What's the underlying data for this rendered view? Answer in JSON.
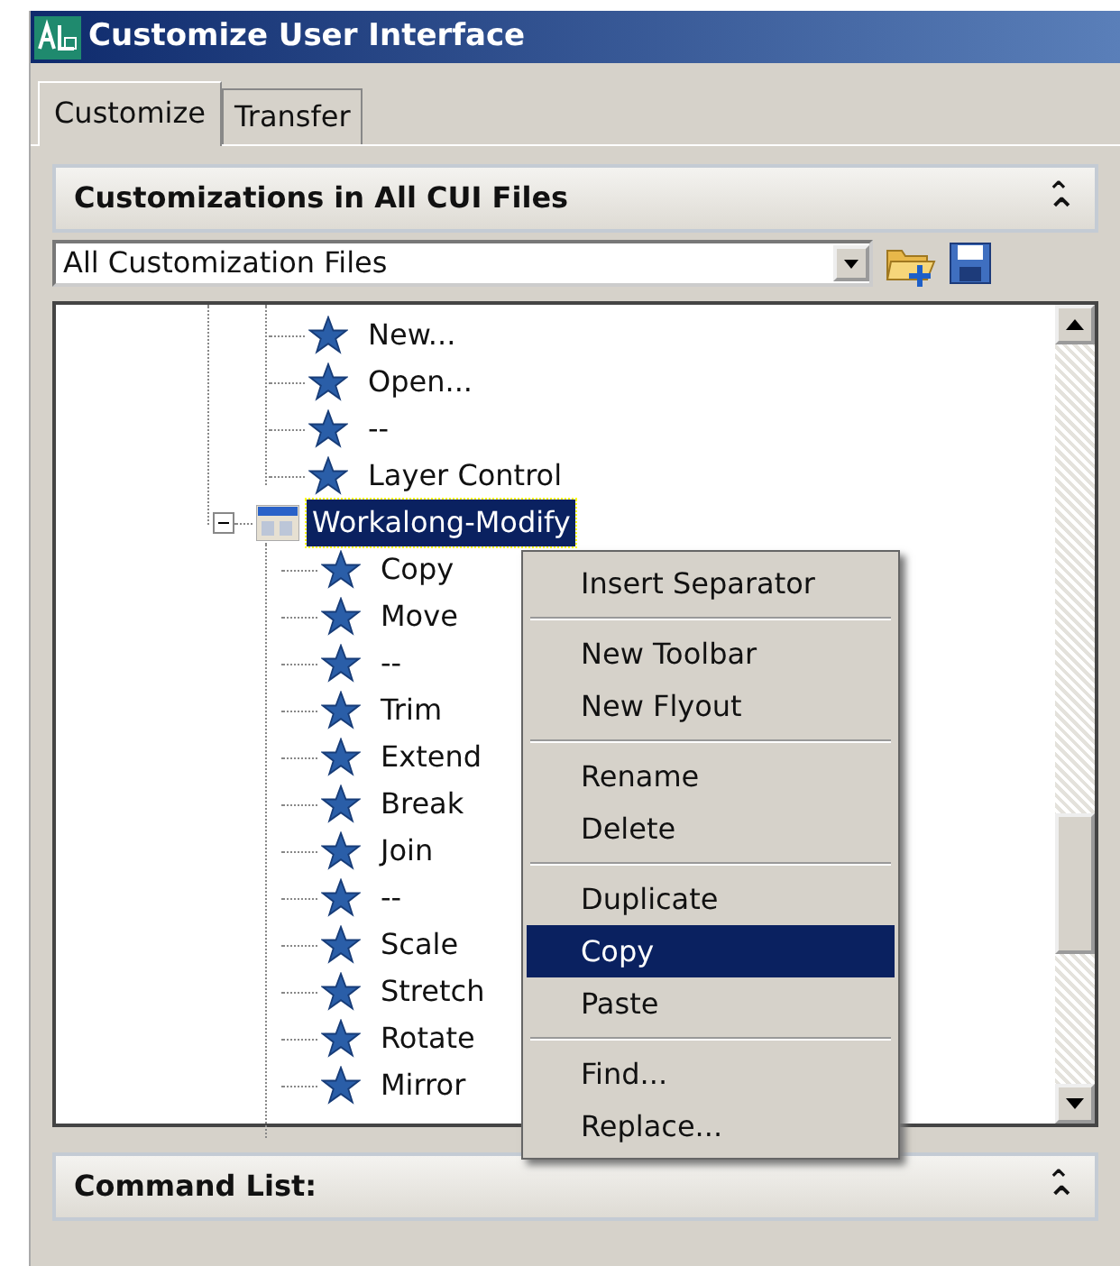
{
  "window": {
    "title": "Customize User Interface"
  },
  "tabs": [
    {
      "label": "Customize",
      "selected": true
    },
    {
      "label": "Transfer",
      "selected": false
    }
  ],
  "customizations_panel": {
    "title": "Customizations in All CUI Files",
    "collapse_glyph": "⌃",
    "file_filter": {
      "value": "All Customization Files"
    }
  },
  "tree": {
    "items": [
      {
        "label": "New...",
        "kind": "command",
        "selected": false
      },
      {
        "label": "Open...",
        "kind": "command",
        "selected": false
      },
      {
        "label": "--",
        "kind": "command",
        "selected": false
      },
      {
        "label": "Layer Control",
        "kind": "command",
        "selected": false
      },
      {
        "label": "Workalong-Modify",
        "kind": "toolbar",
        "selected": true,
        "expanded": true,
        "children": [
          {
            "label": "Copy",
            "kind": "command",
            "selected": false
          },
          {
            "label": "Move",
            "kind": "command",
            "selected": false
          },
          {
            "label": "--",
            "kind": "command",
            "selected": false
          },
          {
            "label": "Trim",
            "kind": "command",
            "selected": false
          },
          {
            "label": "Extend",
            "kind": "command",
            "selected": false
          },
          {
            "label": "Break",
            "kind": "command",
            "selected": false
          },
          {
            "label": "Join",
            "kind": "command",
            "selected": false
          },
          {
            "label": "--",
            "kind": "command",
            "selected": false
          },
          {
            "label": "Scale",
            "kind": "command",
            "selected": false
          },
          {
            "label": "Stretch",
            "kind": "command",
            "selected": false
          },
          {
            "label": "Rotate",
            "kind": "command",
            "selected": false
          },
          {
            "label": "Mirror",
            "kind": "command",
            "selected": false
          }
        ]
      }
    ]
  },
  "context_menu": {
    "items": [
      {
        "kind": "item",
        "label": "Insert Separator",
        "selected": false
      },
      {
        "kind": "separator"
      },
      {
        "kind": "item",
        "label": "New Toolbar",
        "selected": false
      },
      {
        "kind": "item",
        "label": "New Flyout",
        "selected": false
      },
      {
        "kind": "separator"
      },
      {
        "kind": "item",
        "label": "Rename",
        "selected": false
      },
      {
        "kind": "item",
        "label": "Delete",
        "selected": false
      },
      {
        "kind": "separator"
      },
      {
        "kind": "item",
        "label": "Duplicate",
        "selected": false
      },
      {
        "kind": "item",
        "label": "Copy",
        "selected": true
      },
      {
        "kind": "item",
        "label": "Paste",
        "selected": false
      },
      {
        "kind": "separator"
      },
      {
        "kind": "item",
        "label": "Find...",
        "selected": false
      },
      {
        "kind": "item",
        "label": "Replace...",
        "selected": false
      }
    ]
  },
  "command_list_panel": {
    "title": "Command List:",
    "collapse_glyph": "⌃"
  }
}
